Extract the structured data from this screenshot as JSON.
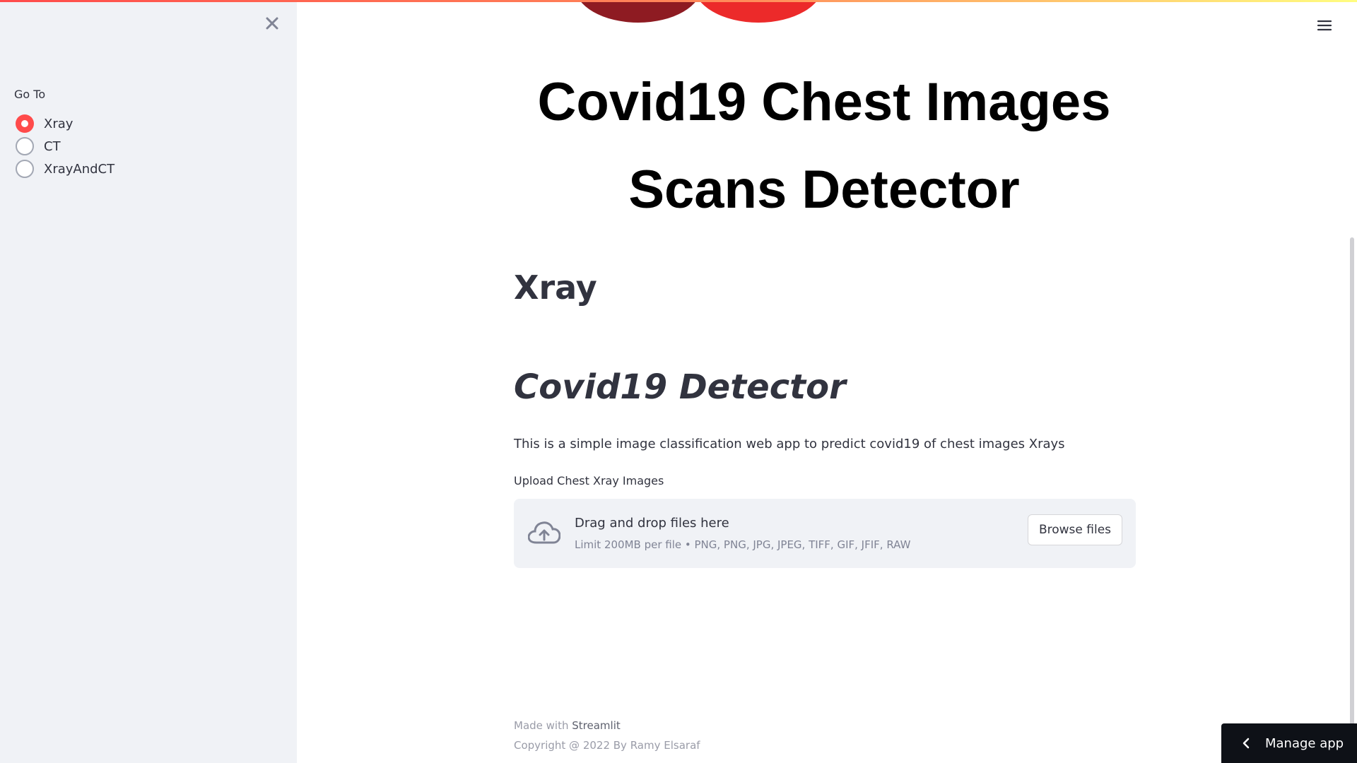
{
  "colors": {
    "accent": "#ff4b4b",
    "sidebar_bg": "#f0f2f6",
    "text": "#31333f",
    "manage_bg": "#0e1117"
  },
  "sidebar": {
    "close_icon": "close-icon",
    "nav_label": "Go To",
    "options": [
      {
        "label": "Xray",
        "selected": true
      },
      {
        "label": "CT",
        "selected": false
      },
      {
        "label": "XrayAndCT",
        "selected": false
      }
    ]
  },
  "header": {
    "menu_icon": "hamburger-menu-icon"
  },
  "main": {
    "title_line1": "Covid19 Chest Images",
    "title_line2": "Scans Detector",
    "section_heading": "Xray",
    "subheading": "Covid19 Detector",
    "description": "This is a simple image classification web app to predict covid19 of chest images Xrays",
    "upload": {
      "label": "Upload Chest Xray Images",
      "icon": "cloud-upload-icon",
      "drop_title": "Drag and drop files here",
      "drop_limit": "Limit 200MB per file • PNG, PNG, JPG, JPEG, TIFF, GIF, JFIF, RAW",
      "browse_label": "Browse files"
    }
  },
  "footer": {
    "made_with_prefix": "Made with",
    "made_with_link": "Streamlit",
    "copyright": "Copyright @ 2022 By Ramy Elsaraf"
  },
  "manage_app": {
    "icon": "chevron-left-icon",
    "label": "Manage app"
  }
}
